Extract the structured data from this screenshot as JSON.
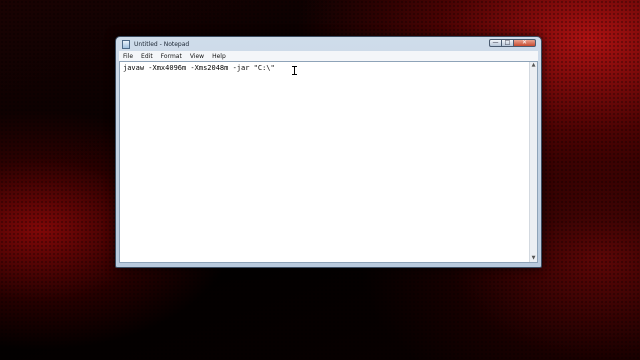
{
  "window": {
    "title": "Untitled - Notepad",
    "controls": {
      "minimize_glyph": "—",
      "maximize_glyph": "□",
      "close_glyph": "✕"
    }
  },
  "menu": {
    "items": [
      "File",
      "Edit",
      "Format",
      "View",
      "Help"
    ]
  },
  "editor": {
    "content": "javaw -Xmx4096m -Xms2048m -jar \"C:\\\""
  },
  "scrollbar": {
    "up_glyph": "▲",
    "down_glyph": "▼"
  },
  "colors": {
    "background_accent": "#c81414",
    "close_button": "#c74a2f"
  }
}
